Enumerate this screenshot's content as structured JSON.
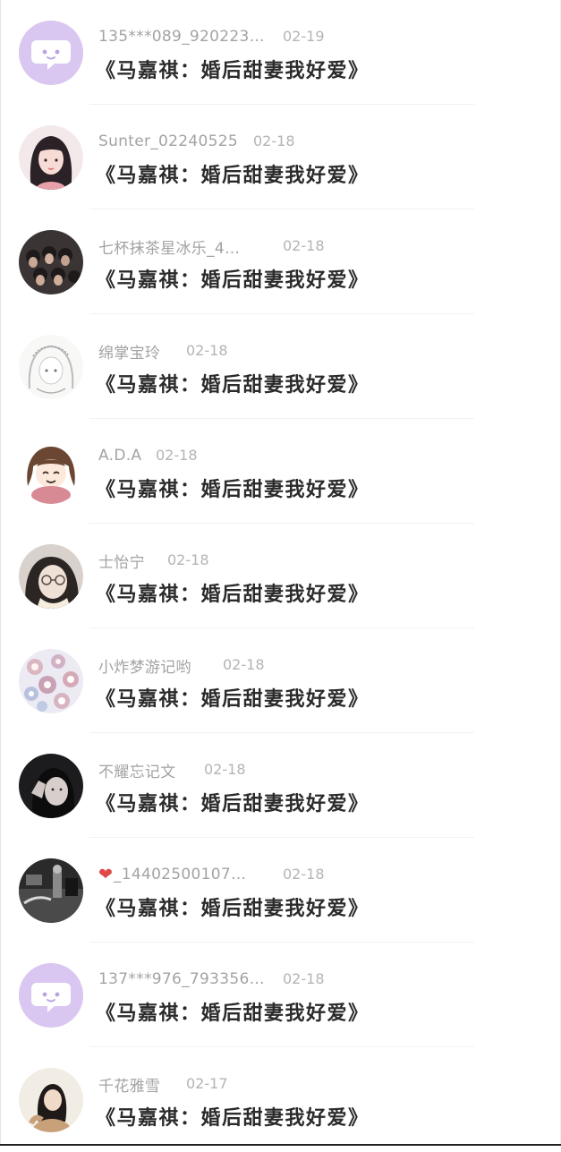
{
  "comments": [
    {
      "username": "135***089_920223…",
      "date": "02-19",
      "book": "《马嘉祺：婚后甜妻我好爱》",
      "avatar": "default-chat-bubble-icon"
    },
    {
      "username": "Sunter_02240525",
      "date": "02-18",
      "book": "《马嘉祺：婚后甜妻我好爱》",
      "avatar": "illustrated-girl-avatar"
    },
    {
      "username": "七杯抹茶星冰乐_4…",
      "date": "02-18",
      "book": "《马嘉祺：婚后甜妻我好爱》",
      "avatar": "group-photo-avatar"
    },
    {
      "username": "绵掌宝玲",
      "date": "02-18",
      "book": "《马嘉祺：婚后甜妻我好爱》",
      "avatar": "sketch-girl-avatar"
    },
    {
      "username": "A.D.A",
      "date": "02-18",
      "book": "《马嘉祺：婚后甜妻我好爱》",
      "avatar": "cartoon-girl-avatar"
    },
    {
      "username": "士怡宁",
      "date": "02-18",
      "book": "《马嘉祺：婚后甜妻我好爱》",
      "avatar": "girl-glasses-avatar"
    },
    {
      "username": "小炸梦游记哟",
      "date": "02-18",
      "book": "《马嘉祺：婚后甜妻我好爱》",
      "avatar": "flowers-avatar"
    },
    {
      "username": "不耀忘记文",
      "date": "02-18",
      "book": "《马嘉祺：婚后甜妻我好爱》",
      "avatar": "dark-selfie-avatar"
    },
    {
      "username": "_14402500107…",
      "date": "02-18",
      "book": "《马嘉祺：婚后甜妻我好爱》",
      "avatar": "bw-photo-avatar",
      "prefix_icon": "heart-icon",
      "prefix_color": "#e04848"
    },
    {
      "username": "137***976_793356…",
      "date": "02-18",
      "book": "《马嘉祺：婚后甜妻我好爱》",
      "avatar": "default-chat-bubble-icon"
    },
    {
      "username": "千花雅雪",
      "date": "02-17",
      "book": "《马嘉祺：婚后甜妻我好爱》",
      "avatar": "girl-photo-avatar"
    }
  ],
  "colors": {
    "username": "#a3a3a3",
    "date": "#b4b4b4",
    "book_title": "#2b2b2b",
    "default_avatar_bg": "#d9c6f1",
    "divider": "#f1f1f1"
  }
}
